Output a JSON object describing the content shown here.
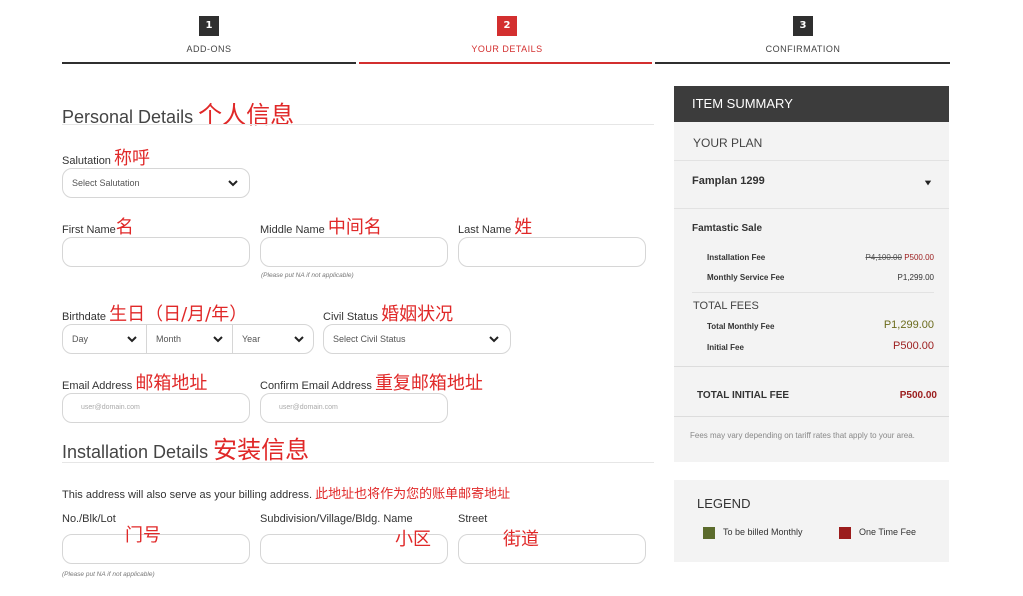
{
  "stepper": {
    "steps": [
      {
        "num": "1",
        "label": "ADD-ONS"
      },
      {
        "num": "2",
        "label": "YOUR DETAILS"
      },
      {
        "num": "3",
        "label": "CONFIRMATION"
      }
    ],
    "colors": {
      "inactive": "#2f2f2f",
      "active": "#d32f2f"
    }
  },
  "personal": {
    "title": "Personal Details",
    "title_cn": "个人信息",
    "salutation": {
      "label": "Salutation",
      "label_cn": "称呼",
      "value": "Select Salutation"
    },
    "first_name": {
      "label": "First Name",
      "label_cn": "名"
    },
    "middle_name": {
      "label": "Middle Name",
      "label_cn": "中间名",
      "note": "(Please put NA if not applicable)"
    },
    "last_name": {
      "label": "Last Name",
      "label_cn": "姓"
    },
    "birthdate": {
      "label": "Birthdate",
      "label_cn": "生日（日/月/年）",
      "day": "Day",
      "month": "Month",
      "year": "Year"
    },
    "civil_status": {
      "label": "Civil Status",
      "label_cn": "婚姻状况",
      "value": "Select Civil Status"
    },
    "email": {
      "label": "Email Address",
      "label_cn": "邮箱地址",
      "placeholder": "user@domain.com"
    },
    "confirm_email": {
      "label": "Confirm Email Address",
      "label_cn": "重复邮箱地址",
      "placeholder": "user@domain.com"
    }
  },
  "installation": {
    "title": "Installation Details",
    "title_cn": "安装信息",
    "note": "This address will also serve as your billing address.",
    "note_cn": "此地址也将作为您的账单邮寄地址",
    "lot": {
      "label": "No./Blk/Lot",
      "label_cn": "门号",
      "note": "(Please put NA if not applicable)"
    },
    "subdivision": {
      "label": "Subdivision/Village/Bldg. Name",
      "label_cn": "小区"
    },
    "street": {
      "label": "Street",
      "label_cn": "街道"
    }
  },
  "summary": {
    "title": "ITEM SUMMARY",
    "plan_label": "YOUR PLAN",
    "plan_value": "Famplan 1299",
    "sale": "Famtastic Sale",
    "installation_fee": {
      "label": "Installation Fee",
      "old": "P4,100.00",
      "new": "P500.00"
    },
    "monthly_fee": {
      "label": "Monthly Service Fee",
      "value": "P1,299.00"
    },
    "total_fees": "TOTAL FEES",
    "total_monthly": {
      "label": "Total Monthly Fee",
      "value": "P1,299.00"
    },
    "initial_fee": {
      "label": "Initial Fee",
      "value": "P500.00"
    },
    "total_initial": {
      "label": "TOTAL INITIAL FEE",
      "value": "P500.00"
    },
    "disclaimer": "Fees may vary depending on tariff rates that apply to your area."
  },
  "legend": {
    "title": "LEGEND",
    "monthly": {
      "label": "To be billed Monthly",
      "color": "#5b6b2c"
    },
    "onetime": {
      "label": "One Time Fee",
      "color": "#9b1c1c"
    }
  }
}
